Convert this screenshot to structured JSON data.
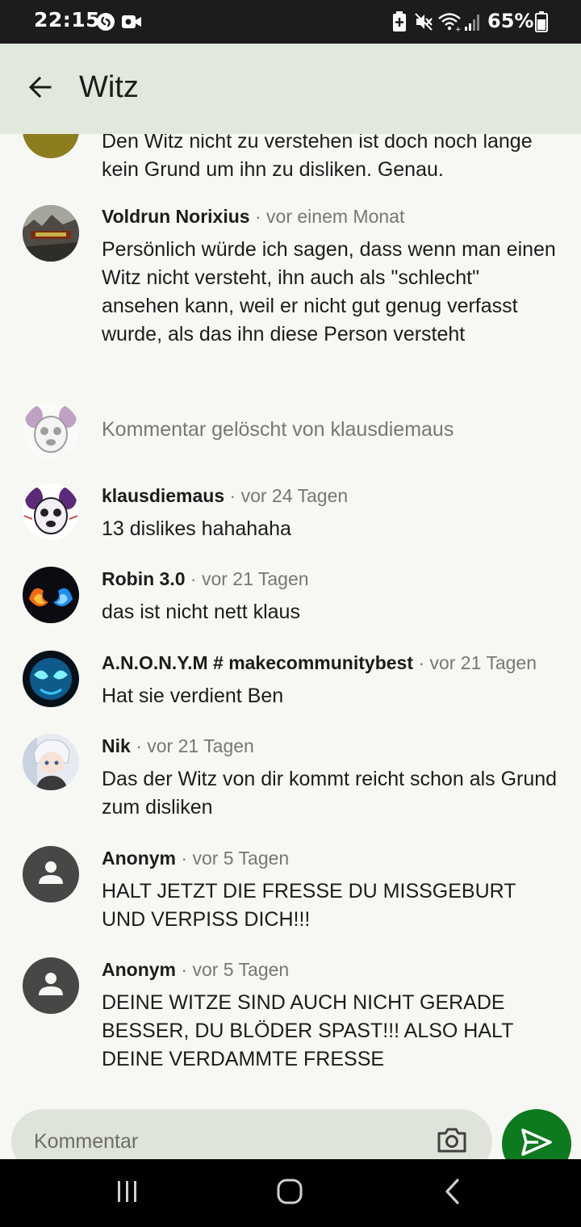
{
  "status_bar": {
    "time": "22:15",
    "battery_percent": "65%",
    "icons": [
      "shazam-icon",
      "video-record-icon",
      "battery-saver-icon",
      "mute-icon",
      "wifi-icon",
      "signal-icon",
      "battery-icon"
    ]
  },
  "app_bar": {
    "back_icon": "arrow-left-icon",
    "title": "Witz"
  },
  "comments": [
    {
      "author": "",
      "time": "",
      "text": "Den Witz nicht zu verstehen ist doch noch lange kein Grund um ihn zu disliken. Genau.",
      "avatar": "olive-avatar"
    },
    {
      "author": "Voldrun Norixius",
      "separator": "·",
      "time": "vor einem Monat",
      "text": "Persönlich würde ich sagen, dass wenn man einen Witz nicht versteht, ihn auch als \"schlecht\" ansehen kann, weil er nicht gut genug verfasst wurde, als das ihn diese Person versteht",
      "avatar": "landscape-avatar"
    },
    {
      "deleted_text": "Kommentar gelöscht von klausdiemaus",
      "avatar": "mouse-avatar-faded"
    },
    {
      "author": "klausdiemaus",
      "separator": "·",
      "time": "vor 24 Tagen",
      "text": "13 dislikes hahahaha",
      "avatar": "mouse-avatar"
    },
    {
      "author": "Robin 3.0",
      "separator": "·",
      "time": "vor 21 Tagen",
      "text": "das ist nicht nett klaus",
      "avatar": "fire-ice-avatar"
    },
    {
      "author": "A.N.O.N.Y.M # makecommunitybest",
      "separator": "·",
      "time": "vor 21 Tagen",
      "text": "Hat sie verdient Ben",
      "avatar": "neon-mask-avatar"
    },
    {
      "author": "Nik",
      "separator": "·",
      "time": "vor 21 Tagen",
      "text": "Das der Witz von dir kommt reicht schon als Grund zum disliken",
      "avatar": "anime-avatar"
    },
    {
      "author": "Anonym",
      "separator": "·",
      "time": "vor 5 Tagen",
      "text": "HALT JETZT DIE FRESSE DU MISSGEBURT UND VERPISS DICH!!!",
      "avatar": "default-person-avatar"
    },
    {
      "author": "Anonym",
      "separator": "·",
      "time": "vor 5 Tagen",
      "text": "DEINE WITZE SIND AUCH NICHT GERADE BESSER, DU BLÖDER SPAST!!! ALSO HALT DEINE VERDAMMTE FRESSE",
      "avatar": "default-person-avatar"
    }
  ],
  "input": {
    "placeholder": "Kommentar",
    "camera_icon": "camera-icon",
    "send_icon": "send-icon"
  },
  "nav_bar": {
    "icons": [
      "recent-apps-icon",
      "home-icon",
      "back-icon"
    ]
  },
  "colors": {
    "app_bar_bg": "#e1e9dd",
    "page_bg": "#f7f8f3",
    "send_button": "#0d7a1f",
    "input_bg": "#dfe4da",
    "secondary_text": "#767873"
  }
}
